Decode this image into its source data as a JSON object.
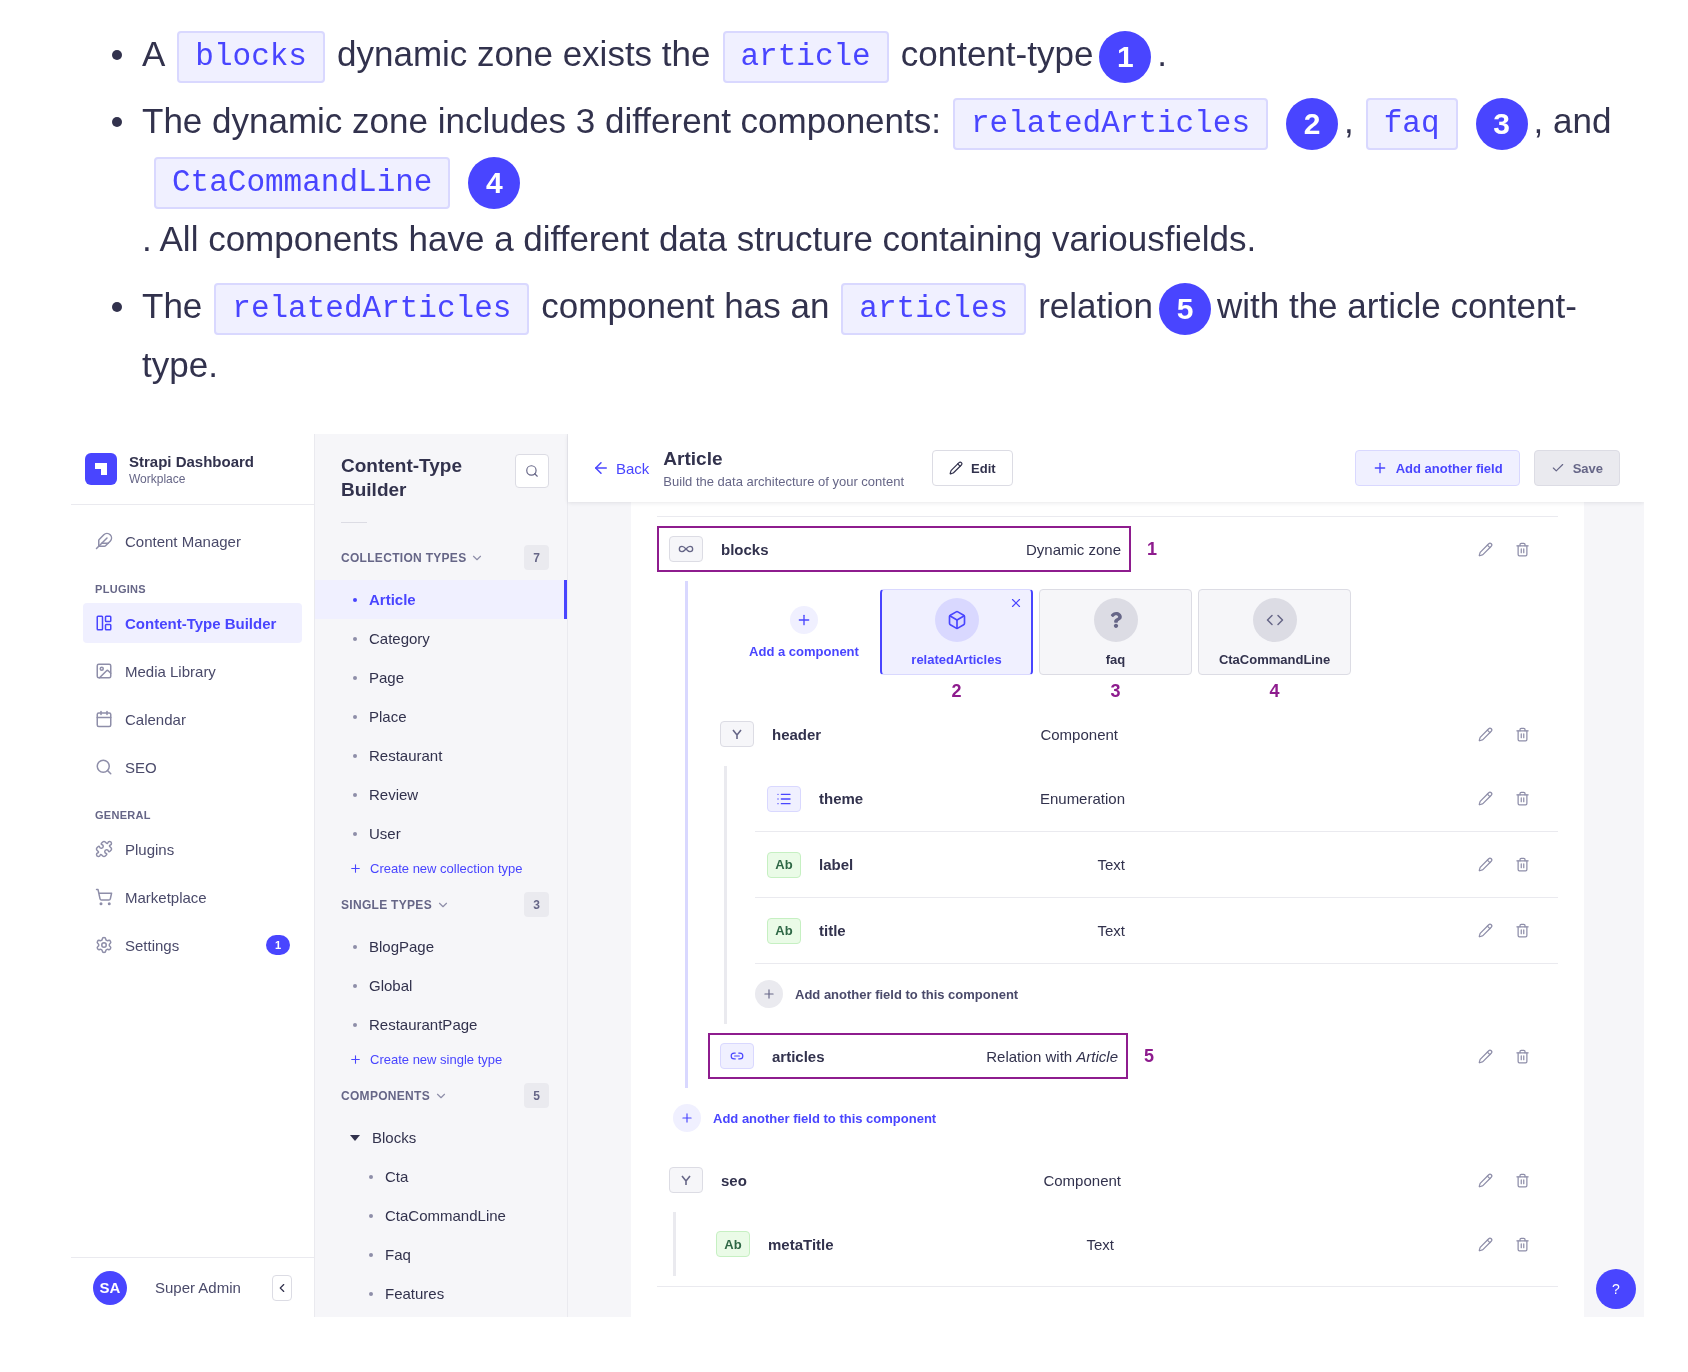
{
  "intro": {
    "bullets": [
      {
        "segments": [
          {
            "kind": "text",
            "text": "A"
          },
          {
            "kind": "code",
            "text": "blocks"
          },
          {
            "kind": "text",
            "text": "dynamic zone exists the"
          },
          {
            "kind": "code",
            "text": "article"
          },
          {
            "kind": "text",
            "text": "content-type"
          },
          {
            "kind": "marker",
            "text": "1"
          },
          {
            "kind": "text",
            "text": "."
          }
        ]
      },
      {
        "segments": [
          {
            "kind": "text",
            "text": "The dynamic zone includes 3 different components:"
          },
          {
            "kind": "code",
            "text": "relatedArticles"
          },
          {
            "kind": "marker",
            "text": "2"
          },
          {
            "kind": "text",
            "text": ","
          },
          {
            "kind": "code",
            "text": "faq"
          },
          {
            "kind": "marker",
            "text": "3"
          },
          {
            "kind": "text",
            "text": ", and"
          },
          {
            "kind": "code",
            "text": "CtaCommandLine"
          },
          {
            "kind": "marker",
            "text": "4"
          },
          {
            "kind": "text",
            "text": ". All components have a different data structure containing various"
          },
          {
            "kind": "text",
            "text": "fields."
          }
        ]
      },
      {
        "segments": [
          {
            "kind": "text",
            "text": "The"
          },
          {
            "kind": "code",
            "text": "relatedArticles"
          },
          {
            "kind": "text",
            "text": "component has an"
          },
          {
            "kind": "code",
            "text": "articles"
          },
          {
            "kind": "text",
            "text": "relation"
          },
          {
            "kind": "marker",
            "text": "5"
          },
          {
            "kind": "text",
            "text": "with the article content-"
          },
          {
            "kind": "text",
            "text": "type."
          }
        ]
      }
    ]
  },
  "sidebar": {
    "brand": {
      "title": "Strapi Dashboard",
      "subtitle": "Workplace"
    },
    "sections": [
      {
        "items": [
          {
            "label": "Content Manager",
            "selected": false
          }
        ]
      },
      {
        "heading": "PLUGINS",
        "items": [
          {
            "label": "Content-Type Builder",
            "selected": true
          },
          {
            "label": "Media Library",
            "selected": false
          },
          {
            "label": "Calendar",
            "selected": false
          },
          {
            "label": "SEO",
            "selected": false
          }
        ]
      },
      {
        "heading": "GENERAL",
        "items": [
          {
            "label": "Plugins",
            "selected": false
          },
          {
            "label": "Marketplace",
            "selected": false
          },
          {
            "label": "Settings",
            "selected": false,
            "badge": "1"
          }
        ]
      }
    ],
    "user": {
      "initials": "SA",
      "name": "Super Admin"
    }
  },
  "builder": {
    "title": "Content-Type Builder",
    "groups": [
      {
        "title": "COLLECTION TYPES",
        "count": "7",
        "items": [
          {
            "label": "Article",
            "selected": true
          },
          {
            "label": "Category",
            "selected": false
          },
          {
            "label": "Page",
            "selected": false
          },
          {
            "label": "Place",
            "selected": false
          },
          {
            "label": "Restaurant",
            "selected": false
          },
          {
            "label": "Review",
            "selected": false
          },
          {
            "label": "User",
            "selected": false
          }
        ],
        "create": "Create new collection type"
      },
      {
        "title": "SINGLE TYPES",
        "count": "3",
        "items": [
          {
            "label": "BlogPage",
            "selected": false
          },
          {
            "label": "Global",
            "selected": false
          },
          {
            "label": "RestaurantPage",
            "selected": false
          }
        ],
        "create": "Create new single type"
      },
      {
        "title": "COMPONENTS",
        "count": "5",
        "items": [
          {
            "label": "Blocks",
            "selected": false,
            "expanded": true,
            "children": [
              {
                "label": "Cta",
                "selected": false
              },
              {
                "label": "CtaCommandLine",
                "selected": false
              },
              {
                "label": "Faq",
                "selected": false
              },
              {
                "label": "Features",
                "selected": false
              }
            ]
          }
        ]
      }
    ]
  },
  "header": {
    "back": "Back",
    "title": "Article",
    "subtitle": "Build the data architecture of your content",
    "edit": "Edit",
    "add": "Add another field",
    "save": "Save",
    "save_disabled": true
  },
  "fields": [
    {
      "kind": "dynamic_zone",
      "name": "blocks",
      "type": "Dynamic zone",
      "highlighted": true,
      "annotation": "1",
      "add_component": "Add a component",
      "components": [
        {
          "name": "relatedArticles",
          "selected": true,
          "annotation": "2"
        },
        {
          "name": "faq",
          "selected": false,
          "annotation": "3"
        },
        {
          "name": "CtaCommandLine",
          "selected": false,
          "annotation": "4"
        }
      ],
      "children": [
        {
          "kind": "component",
          "name": "header",
          "type": "Component",
          "children": [
            {
              "kind": "enumeration",
              "name": "theme",
              "type": "Enumeration"
            },
            {
              "kind": "text",
              "icon_text": "Ab",
              "name": "label",
              "type": "Text"
            },
            {
              "kind": "text",
              "icon_text": "Ab",
              "name": "title",
              "type": "Text"
            }
          ],
          "add_field": "Add another field to this component"
        },
        {
          "kind": "relation",
          "name": "articles",
          "type": "Relation with *Article*",
          "highlighted": true,
          "annotation": "5"
        }
      ],
      "add_field": "Add another field to this component"
    },
    {
      "kind": "component",
      "name": "seo",
      "type": "Component",
      "children": [
        {
          "kind": "text",
          "icon_text": "Ab",
          "name": "metaTitle",
          "type": "Text"
        }
      ]
    }
  ],
  "help_button": "?"
}
